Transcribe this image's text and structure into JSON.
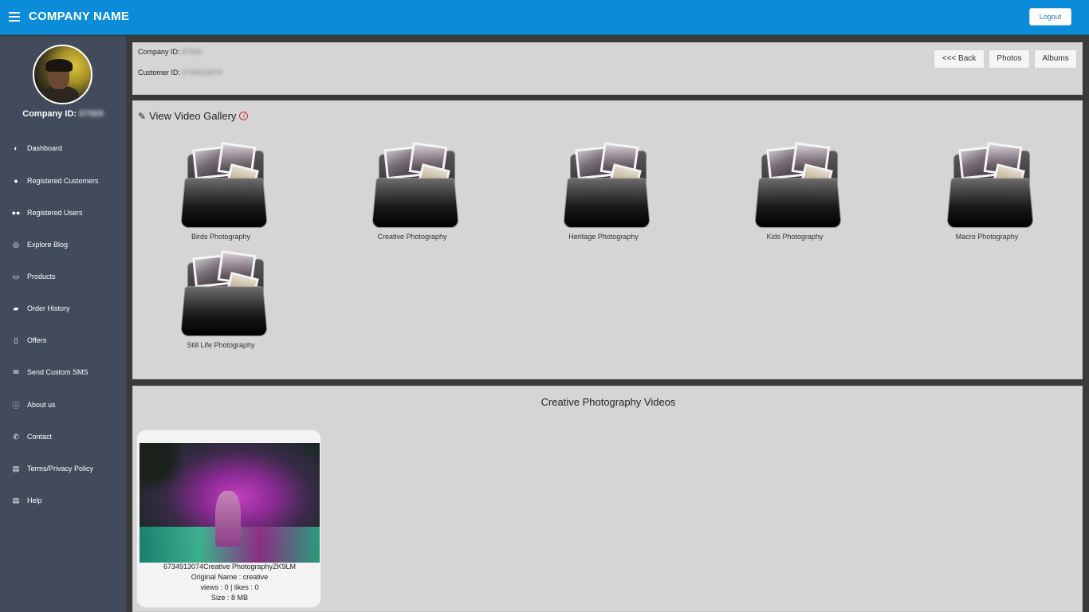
{
  "header": {
    "brand": "COMPANY NAME",
    "logout_label": "Logout"
  },
  "sidebar": {
    "company_id_label": "Company ID:",
    "company_id_value": "67569",
    "items": [
      {
        "label": "Dashboard",
        "icon": "dashboard-icon",
        "glyph": "◐"
      },
      {
        "label": "Registered Customers",
        "icon": "user-icon",
        "glyph": "●"
      },
      {
        "label": "Registered Users",
        "icon": "users-icon",
        "glyph": "●●"
      },
      {
        "label": "Explore Blog",
        "icon": "compass-icon",
        "glyph": "◎"
      },
      {
        "label": "Products",
        "icon": "tag-icon",
        "glyph": "▭"
      },
      {
        "label": "Order History",
        "icon": "book-icon",
        "glyph": "▰"
      },
      {
        "label": "Offers",
        "icon": "mobile-icon",
        "glyph": "▯"
      },
      {
        "label": "Send Custom SMS",
        "icon": "envelope-icon",
        "glyph": "✉"
      },
      {
        "label": "About us",
        "icon": "info-icon",
        "glyph": "ⓘ"
      },
      {
        "label": "Contact",
        "icon": "phone-icon",
        "glyph": "✆"
      },
      {
        "label": "Terms/Privacy Policy",
        "icon": "document-icon",
        "glyph": "▤"
      },
      {
        "label": "Help",
        "icon": "help-document-icon",
        "glyph": "▤"
      }
    ]
  },
  "info": {
    "company_id_label": "Company ID:",
    "company_id_value": "67569",
    "customer_id_label": "Customer ID:",
    "customer_id_value": "6734913074"
  },
  "buttons": {
    "back": "<<< Back",
    "photos": "Photos",
    "albums": "Albums"
  },
  "gallery": {
    "title": "View Video Gallery",
    "albums": [
      "Birds Photography",
      "Creative Photography",
      "Heritage Photography",
      "Kids Photography",
      "Macro Photography",
      "Still Life Photography"
    ]
  },
  "videos": {
    "title": "Creative Photography Videos",
    "items": [
      {
        "file_name": "6734913074Creative PhotographyZK9LM",
        "original_name_label": "Original Name :",
        "original_name": "creative",
        "views_label": "views :",
        "views": "0",
        "likes_label": "| likes :",
        "likes": "0",
        "size_label": "Size :",
        "size": "8 MB"
      }
    ]
  }
}
